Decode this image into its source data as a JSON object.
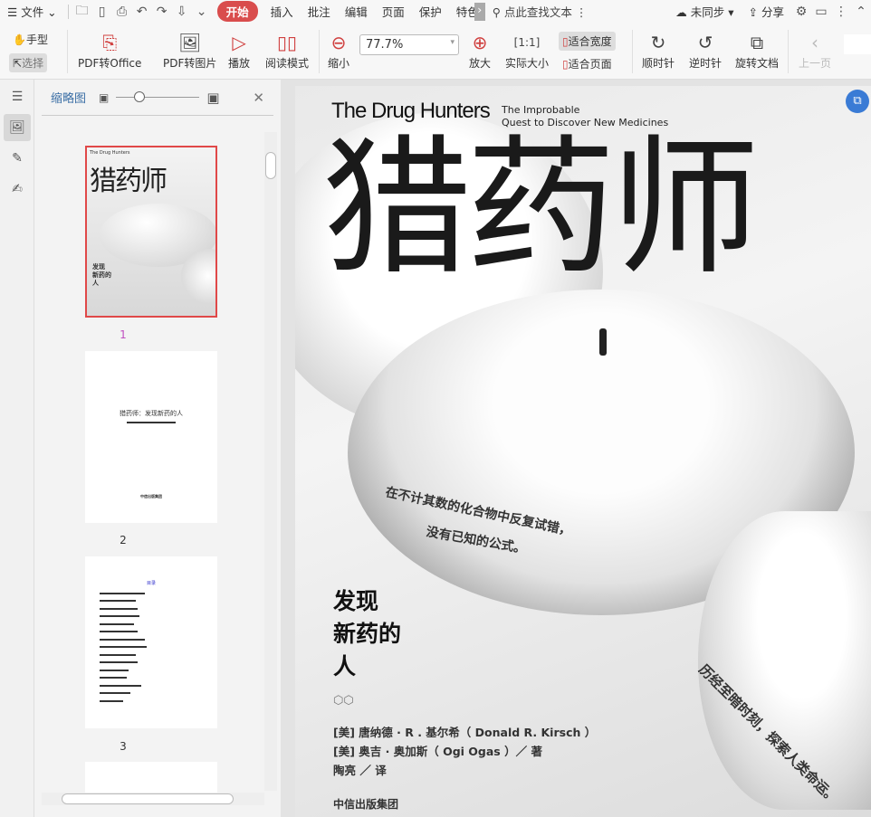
{
  "menu": {
    "file": "文件",
    "tabs": [
      "开始",
      "插入",
      "批注",
      "编辑",
      "页面",
      "保护",
      "特色"
    ],
    "search": "点此查找文本",
    "sync": "未同步",
    "share": "分享"
  },
  "toolbar": {
    "hand": "手型",
    "select": "选择",
    "pdf_office": "PDF转Office",
    "pdf_image": "PDF转图片",
    "play": "播放",
    "read_mode": "阅读模式",
    "zoom_out": "缩小",
    "zoom_value": "77.7%",
    "zoom_in": "放大",
    "actual_size": "实际大小",
    "fit_width": "适合宽度",
    "fit_page": "适合页面",
    "rotate_cw": "顺时针",
    "rotate_ccw": "逆时针",
    "rotate_doc": "旋转文档",
    "prev_page": "上一页"
  },
  "thumbnails": {
    "title": "缩略图",
    "pages": [
      {
        "num": "1"
      },
      {
        "num": "2",
        "title": "猎药师：发现新药的人",
        "footer": "中信出版集团"
      },
      {
        "num": "3",
        "title": "目录"
      }
    ],
    "selected": 1
  },
  "cover": {
    "en_title": "The Drug Hunters",
    "en_sub1": "The Improbable",
    "en_sub2": "Quest to Discover New Medicines",
    "cn_title": "猎药师",
    "quote1": "在不计其数的化合物中反复试错，",
    "quote2": "没有已知的公式。",
    "subtitle1": "发现",
    "subtitle2": "新药的",
    "subtitle3": "人",
    "author1": "[美] 唐纳德 · R . 基尔希（ Donald R. Kirsch ）",
    "author2": "[美] 奥吉 · 奥加斯（ Ogi Ogas ）／ 著",
    "translator": "陶亮 ／ 译",
    "publisher": "中信出版集团",
    "side_text": "历经至暗时刻，探索人类命运。"
  },
  "colors": {
    "accent": "#d94d4d",
    "selected_border": "#e04848",
    "link": "#3a7bd5"
  }
}
